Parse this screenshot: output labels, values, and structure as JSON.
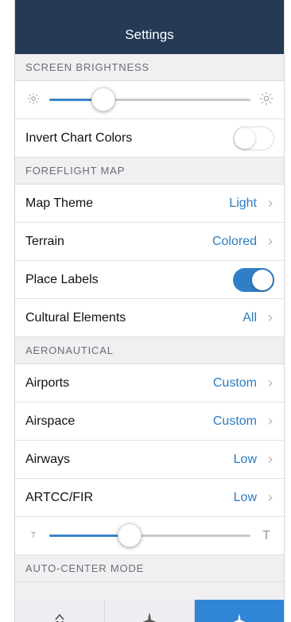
{
  "title": "Settings",
  "brightness": {
    "header": "SCREEN BRIGHTNESS",
    "level": 0.27,
    "min_icon": "sun-small-icon",
    "max_icon": "sun-large-icon"
  },
  "invert": {
    "label": "Invert Chart Colors",
    "on": false
  },
  "map": {
    "header": "FOREFLIGHT MAP",
    "theme_label": "Map Theme",
    "theme_value": "Light",
    "terrain_label": "Terrain",
    "terrain_value": "Colored",
    "place_labels_label": "Place Labels",
    "place_labels_on": true,
    "cultural_label": "Cultural Elements",
    "cultural_value": "All"
  },
  "aero": {
    "header": "AERONAUTICAL",
    "airports_label": "Airports",
    "airports_value": "Custom",
    "airspace_label": "Airspace",
    "airspace_value": "Custom",
    "airways_label": "Airways",
    "airways_value": "Low",
    "artcc_label": "ARTCC/FIR",
    "artcc_value": "Low",
    "text_size_level": 0.4,
    "small_t": "T",
    "large_t": "T"
  },
  "autocenter": {
    "header": "AUTO-CENTER MODE",
    "north_letter": "N",
    "modes": [
      "north-up-icon",
      "track-up-icon",
      "heading-up-icon"
    ],
    "active_index": 2
  },
  "colors": {
    "titlebar": "#243a55",
    "accent": "#2f7fc6",
    "link": "#2b7bc0"
  }
}
